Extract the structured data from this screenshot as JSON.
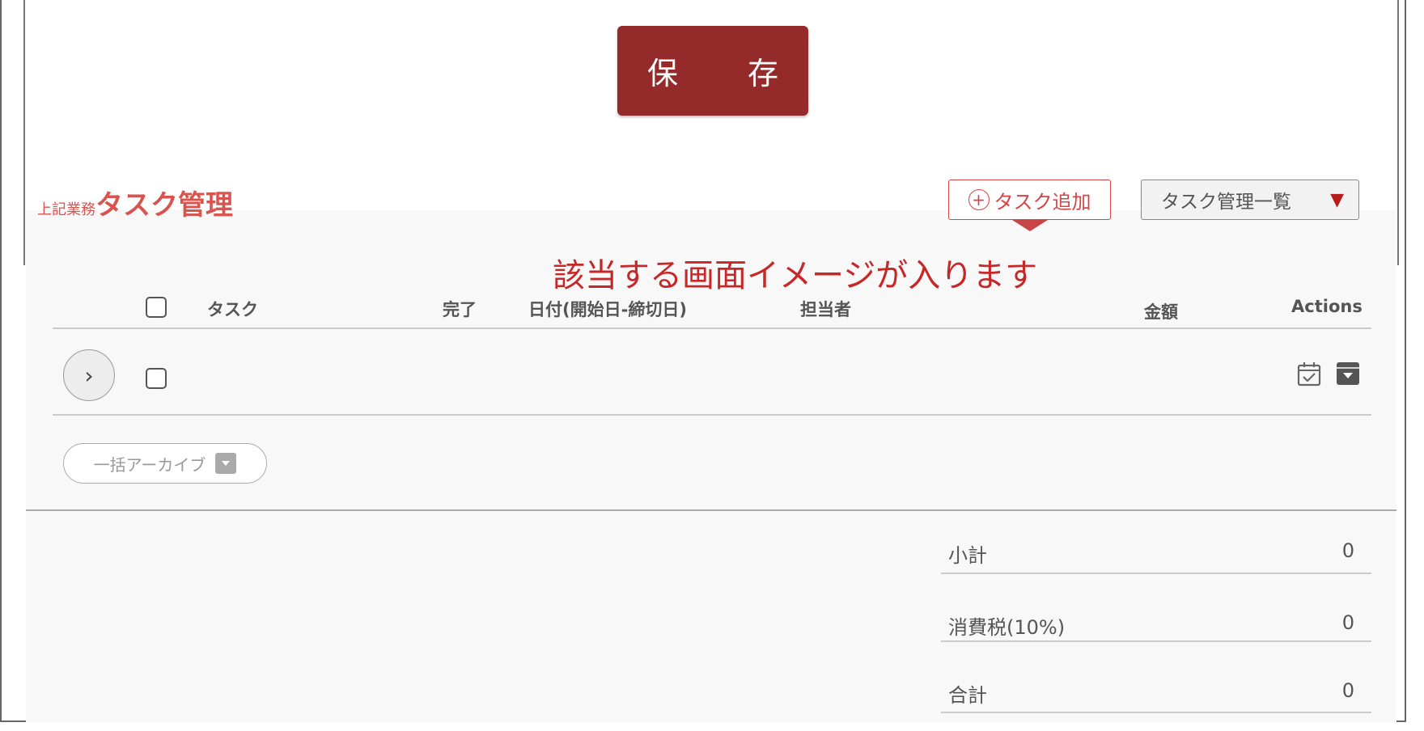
{
  "toolbar": {
    "save_label": "保　存"
  },
  "section": {
    "prefix": "上記業務",
    "title": "タスク管理"
  },
  "actions": {
    "add_task_label": "タスク追加",
    "list_view_label": "タスク管理一覧"
  },
  "placeholder_note": "該当する画面イメージが入ります",
  "table": {
    "columns": [
      "タスク",
      "完了",
      "日付(開始日-締切日)",
      "担当者",
      "金額",
      "Actions"
    ]
  },
  "bulk_archive_label": "一括アーカイブ",
  "summary": [
    {
      "label": "小計",
      "value": "0"
    },
    {
      "label": "消費税(10%)",
      "value": "0"
    },
    {
      "label": "合計",
      "value": "0"
    }
  ],
  "colors": {
    "brand": "#952a2a",
    "accent": "#d64545",
    "panel": "#f8f8f8"
  },
  "icons": [
    "plus-circle-icon",
    "caret-down-icon",
    "chevron-right-icon",
    "calendar-check-icon",
    "archive-icon"
  ]
}
